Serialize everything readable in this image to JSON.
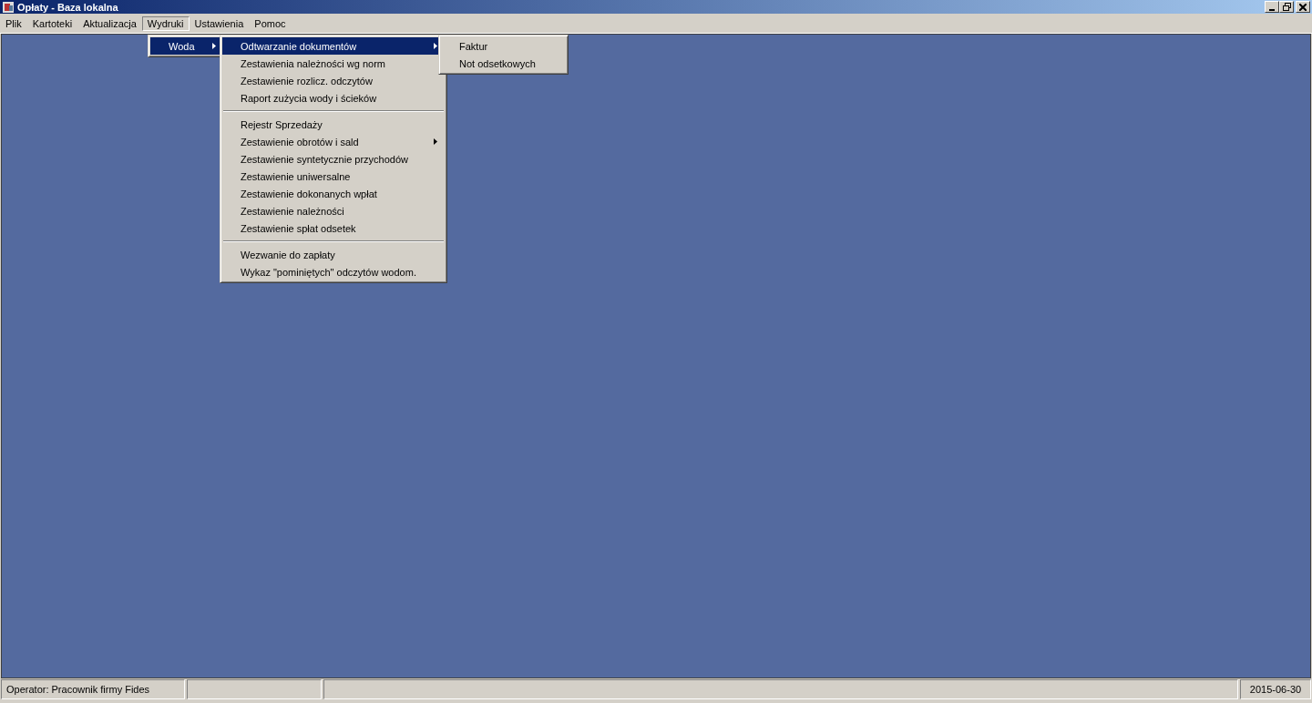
{
  "window": {
    "title": "Opłaty - Baza lokalna"
  },
  "menubar": [
    {
      "label": "Plik",
      "selected": false
    },
    {
      "label": "Kartoteki",
      "selected": false
    },
    {
      "label": "Aktualizacja",
      "selected": false
    },
    {
      "label": "Wydruki",
      "selected": true
    },
    {
      "label": "Ustawienia",
      "selected": false
    },
    {
      "label": "Pomoc",
      "selected": false
    }
  ],
  "menus": [
    {
      "items": [
        {
          "kind": "item",
          "label": "Woda",
          "submenu": true,
          "selected": true
        }
      ]
    },
    {
      "items": [
        {
          "kind": "item",
          "label": "Odtwarzanie dokumentów",
          "submenu": true,
          "selected": true
        },
        {
          "kind": "item",
          "label": "Zestawienia należności wg norm",
          "submenu": false,
          "selected": false
        },
        {
          "kind": "item",
          "label": "Zestawienie rozlicz. odczytów",
          "submenu": false,
          "selected": false
        },
        {
          "kind": "item",
          "label": "Raport zużycia wody i ścieków",
          "submenu": false,
          "selected": false
        },
        {
          "kind": "separator"
        },
        {
          "kind": "item",
          "label": "Rejestr Sprzedaży",
          "submenu": false,
          "selected": false
        },
        {
          "kind": "item",
          "label": "Zestawienie obrotów i sald",
          "submenu": true,
          "selected": false
        },
        {
          "kind": "item",
          "label": "Zestawienie syntetycznie przychodów",
          "submenu": false,
          "selected": false
        },
        {
          "kind": "item",
          "label": "Zestawienie uniwersalne",
          "submenu": false,
          "selected": false
        },
        {
          "kind": "item",
          "label": "Zestawienie dokonanych wpłat",
          "submenu": false,
          "selected": false
        },
        {
          "kind": "item",
          "label": "Zestawienie należności",
          "submenu": false,
          "selected": false
        },
        {
          "kind": "item",
          "label": "Zestawienie spłat odsetek",
          "submenu": false,
          "selected": false
        },
        {
          "kind": "separator"
        },
        {
          "kind": "item",
          "label": "Wezwanie do zapłaty",
          "submenu": false,
          "selected": false
        },
        {
          "kind": "item",
          "label": "Wykaz \"pominiętych\" odczytów wodom.",
          "submenu": false,
          "selected": false
        }
      ]
    },
    {
      "items": [
        {
          "kind": "item",
          "label": "Faktur",
          "submenu": false,
          "selected": false
        },
        {
          "kind": "item",
          "label": "Not odsetkowych",
          "submenu": false,
          "selected": false
        }
      ]
    }
  ],
  "status_bar": {
    "operator": "Operator: Pracownik firmy Fides",
    "date": "2015-06-30"
  }
}
